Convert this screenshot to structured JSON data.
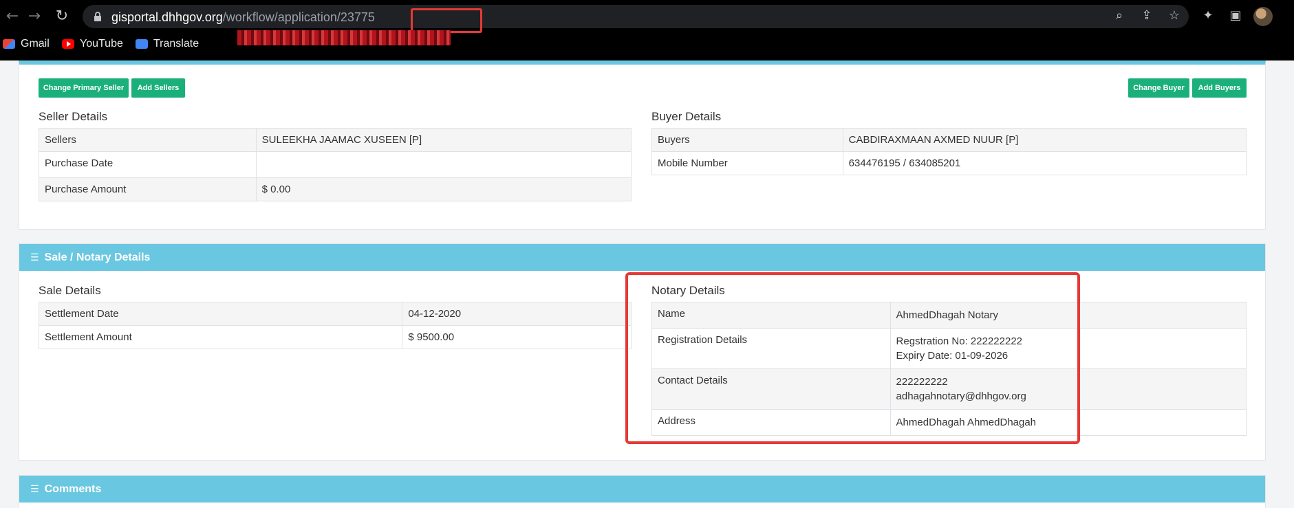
{
  "browser": {
    "url_host": "gisportal.dhhgov.org",
    "url_path": "/workflow/application/23775",
    "bookmarks": [
      {
        "label": "Gmail",
        "icon": "gmail-icon"
      },
      {
        "label": "YouTube",
        "icon": "youtube-icon"
      },
      {
        "label": "Translate",
        "icon": "translate-icon"
      }
    ],
    "icons": [
      "back-icon",
      "forward-icon",
      "reload-icon",
      "lock-icon",
      "zoom-icon",
      "share-icon",
      "star-icon",
      "extensions-icon",
      "side-panel-icon",
      "avatar"
    ]
  },
  "parties": {
    "buttons": {
      "change_primary_seller": "Change Primary Seller",
      "add_sellers": "Add Sellers",
      "change_buyer": "Change Buyer",
      "add_buyers": "Add Buyers"
    },
    "seller": {
      "title": "Seller Details",
      "rows": [
        {
          "label": "Sellers",
          "value": "SULEEKHA JAAMAC XUSEEN [P]"
        },
        {
          "label": "Purchase Date",
          "value": ""
        },
        {
          "label": "Purchase Amount",
          "value": "$ 0.00"
        }
      ]
    },
    "buyer": {
      "title": "Buyer Details",
      "rows": [
        {
          "label": "Buyers",
          "value": "CABDIRAXMAAN AXMED NUUR [P]"
        },
        {
          "label": "Mobile Number",
          "value": "634476195 / 634085201"
        }
      ]
    }
  },
  "sale_notary": {
    "header": "Sale / Notary Details",
    "sale": {
      "title": "Sale Details",
      "rows": [
        {
          "label": "Settlement Date",
          "value": "04-12-2020"
        },
        {
          "label": "Settlement Amount",
          "value": "$ 9500.00"
        }
      ]
    },
    "notary": {
      "title": "Notary Details",
      "rows": [
        {
          "label": "Name",
          "lines": [
            "AhmedDhagah Notary"
          ]
        },
        {
          "label": "Registration Details",
          "lines": [
            "Regstration No: 222222222",
            "Expiry Date: 01-09-2026"
          ]
        },
        {
          "label": "Contact Details",
          "lines": [
            "222222222",
            "adhagahnotary@dhhgov.org"
          ]
        },
        {
          "label": "Address",
          "lines": [
            "AhmedDhagah AhmedDhagah"
          ]
        }
      ]
    }
  },
  "comments": {
    "header": "Comments"
  },
  "colors": {
    "header_blue": "#6ac7e1",
    "button_green": "#1bb07a",
    "highlight_red": "#e53935"
  }
}
